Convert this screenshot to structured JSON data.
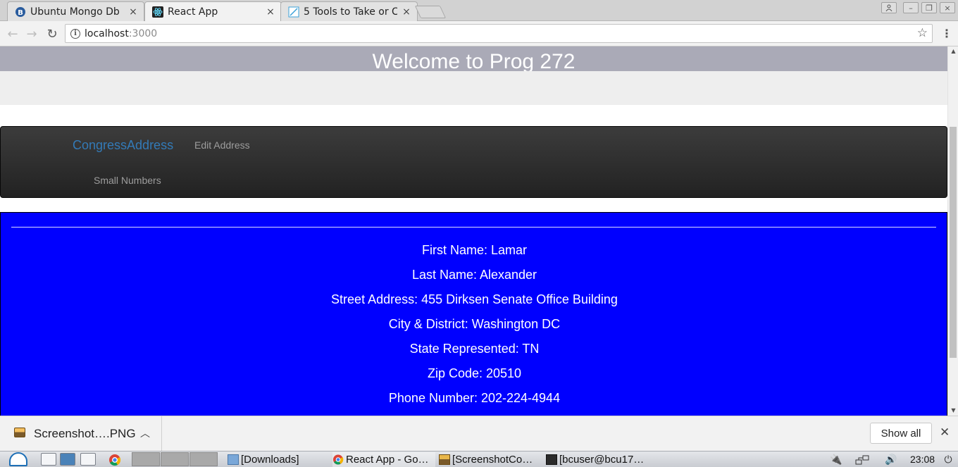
{
  "browser": {
    "tabs": [
      {
        "title": "Ubuntu Mongo Db",
        "active": false
      },
      {
        "title": "React App",
        "active": true
      },
      {
        "title": "5 Tools to Take or C",
        "active": false
      }
    ],
    "address": {
      "host": "localhost",
      "port": ":3000"
    }
  },
  "page": {
    "header_title": "Welcome to Prog 272",
    "navbar": {
      "brand": "CongressAddress",
      "links": [
        "Edit Address",
        "Small Numbers"
      ]
    },
    "address": {
      "fields": [
        "First Name: Lamar",
        "Last Name: Alexander",
        "Street Address: 455 Dirksen Senate Office Building",
        "City & District: Washington DC",
        "State Represented: TN",
        "Zip Code: 20510",
        "Phone Number: 202-224-4944"
      ]
    },
    "colors": {
      "header": "#aaaab7",
      "navbar": "#222222",
      "brand": "#337ab7",
      "panel": "#0000ff"
    }
  },
  "downloads": {
    "file_name": "Screenshot….PNG",
    "show_all": "Show all"
  },
  "taskbar": {
    "items": [
      "[Downloads]",
      "React App - Go…",
      "[ScreenshotCo…",
      "[bcuser@bcu17…"
    ],
    "clock": "23:08"
  }
}
